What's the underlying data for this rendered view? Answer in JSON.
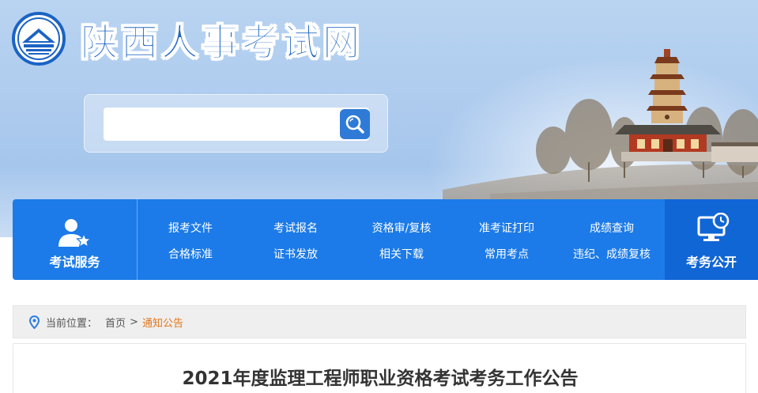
{
  "site": {
    "title": "陕西人事考试网"
  },
  "search": {
    "value": "",
    "placeholder": ""
  },
  "nav": {
    "left_label": "考试服务",
    "right_label": "考务公开",
    "links": [
      {
        "label": "报考文件"
      },
      {
        "label": "考试报名"
      },
      {
        "label": "资格审/复核"
      },
      {
        "label": "准考证打印"
      },
      {
        "label": "成绩查询"
      },
      {
        "label": "合格标准"
      },
      {
        "label": "证书发放"
      },
      {
        "label": "相关下载"
      },
      {
        "label": "常用考点"
      },
      {
        "label": "违纪、成绩复核"
      }
    ]
  },
  "breadcrumb": {
    "prefix": "当前位置：",
    "home": "首页",
    "separator": ">",
    "current": "通知公告"
  },
  "article": {
    "title": "2021年度监理工程师职业资格考试考务工作公告"
  },
  "colors": {
    "brand_blue": "#1c7be8",
    "brand_dark_blue": "#1166d6",
    "breadcrumb_current": "#e2761a"
  },
  "icons": {
    "logo": "building-emblem-icon",
    "search": "search-icon",
    "exam_service": "user-star-icon",
    "exam_affairs": "monitor-clock-icon",
    "location": "location-pin-icon"
  }
}
